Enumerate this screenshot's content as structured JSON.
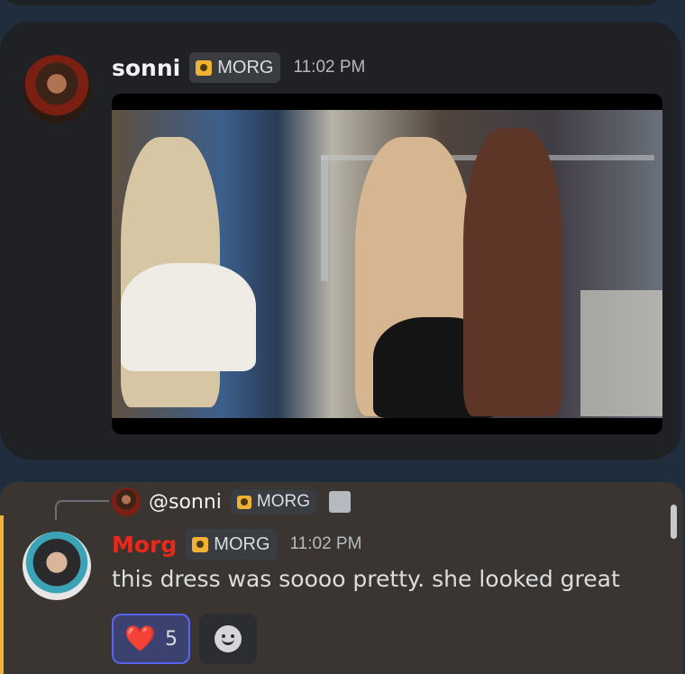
{
  "messages": [
    {
      "author": "sonni",
      "role_tag": "MORG",
      "time": "11:02 PM",
      "has_media": true
    }
  ],
  "reply": {
    "replied_to": "@sonni",
    "replied_tag": "MORG",
    "attachment_icon": "image-icon",
    "author": "Morg",
    "author_color": "#e8291c",
    "role_tag": "MORG",
    "time": "11:02 PM",
    "text": "this dress was soooo pretty. she looked great",
    "reactions": [
      {
        "emoji": "❤️",
        "count": "5",
        "active": true
      }
    ],
    "add_reaction_icon": "smiley-icon"
  },
  "colors": {
    "accent": "#5865f2",
    "highlight_bar": "#f0b232",
    "background": "#1f2d3c"
  }
}
